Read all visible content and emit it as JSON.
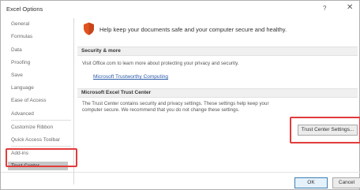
{
  "window": {
    "title": "Excel Options",
    "help_glyph": "?",
    "close_glyph": "✕"
  },
  "sidebar": {
    "items": [
      {
        "label": "General"
      },
      {
        "label": "Formulas"
      },
      {
        "label": "Data"
      },
      {
        "label": "Proofing"
      },
      {
        "label": "Save"
      },
      {
        "label": "Language"
      },
      {
        "label": "Ease of Access"
      },
      {
        "label": "Advanced"
      },
      {
        "label": "Customize Ribbon"
      },
      {
        "label": "Quick Access Toolbar"
      },
      {
        "label": "Add-ins"
      },
      {
        "label": "Trust Center"
      }
    ],
    "active": "Trust Center"
  },
  "header": {
    "icon": "shield-icon",
    "text": "Help keep your documents safe and your computer secure and healthy."
  },
  "security_more": {
    "title": "Security & more",
    "text": "Visit Office.com to learn more about protecting your privacy and security.",
    "link": "Microsoft Trustworthy Computing"
  },
  "trust_center": {
    "title": "Microsoft Excel Trust Center",
    "text_line1": "The Trust Center contains security and privacy settings. These settings help keep your",
    "text_line2": "computer secure. We recommend that you do not change these settings.",
    "button": "Trust Center Settings..."
  },
  "footer": {
    "ok": "OK",
    "cancel": "Cancel"
  },
  "colors": {
    "highlight": "#e33b3b",
    "shield": "#e0531f",
    "link": "#2b5aa8"
  }
}
